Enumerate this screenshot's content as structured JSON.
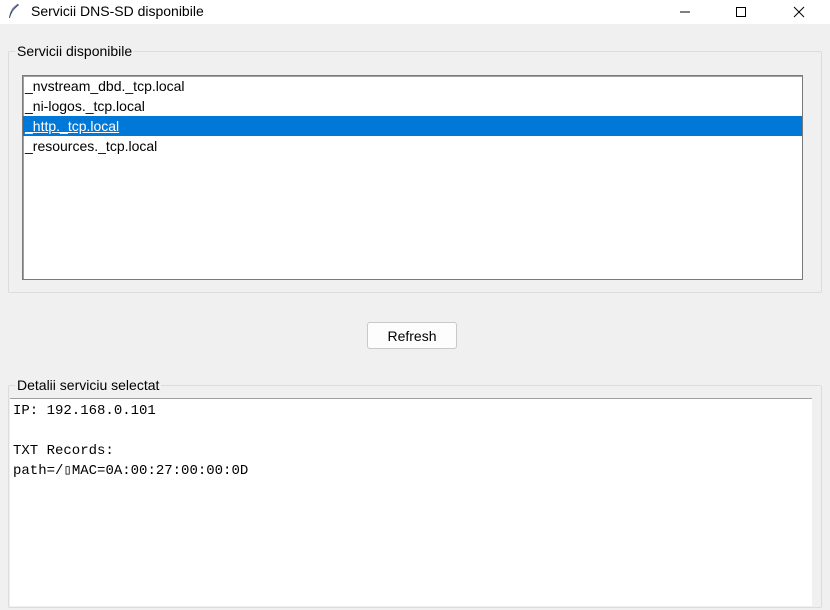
{
  "window": {
    "title": "Servicii DNS-SD disponibile",
    "icon": "feather-icon"
  },
  "services_group": {
    "label": "Servicii disponibile",
    "items": [
      {
        "label": "_nvstream_dbd._tcp.local",
        "selected": false
      },
      {
        "label": "_ni-logos._tcp.local",
        "selected": false
      },
      {
        "label": "_http._tcp.local",
        "selected": true
      },
      {
        "label": "_resources._tcp.local",
        "selected": false
      }
    ]
  },
  "refresh_button": {
    "label": "Refresh"
  },
  "details_group": {
    "label": "Detalii serviciu selectat",
    "lines": [
      "IP: 192.168.0.101",
      "",
      "TXT Records:",
      "path=/▯MAC=0A:00:27:00:00:0D"
    ]
  },
  "colors": {
    "selection": "#0078d7",
    "background": "#f0f0f0"
  }
}
